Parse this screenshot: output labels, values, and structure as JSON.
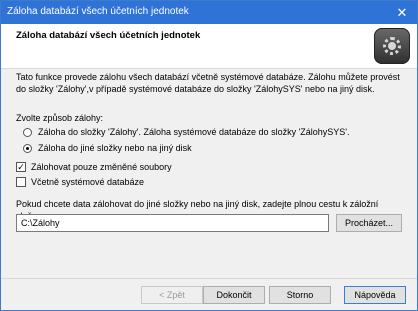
{
  "window": {
    "title": "Záloha databází všech účetních jednotek",
    "close_glyph": "✕"
  },
  "header": {
    "title": "Záloha databází všech účetních jednotek"
  },
  "description": "Tato funkce provede zálohu všech databází včetně systémové databáze. Zálohu můžete provést do složky 'Zálohy',v případě systémové databáze do složky 'ZálohySYS' nebo na jiný disk.",
  "backup_mode": {
    "label": "Zvolte způsob zálohy:",
    "options": [
      {
        "label": "Záloha do složky 'Zálohy'. Záloha systémové databáze do složky 'ZálohySYS'.",
        "selected": false
      },
      {
        "label": "Záloha do jiné složky nebo na jiný disk",
        "selected": true
      }
    ]
  },
  "checkboxes": [
    {
      "label": "Zálohovat pouze změněné soubory",
      "checked": true
    },
    {
      "label": "Včetně systémové databáze",
      "checked": false
    }
  ],
  "path": {
    "instruction": "Pokud chcete data zálohovat do jiné složky nebo na jiný disk, zadejte plnou cestu k záložní složce.",
    "value": "C:\\Zálohy",
    "browse_label": "Procházet..."
  },
  "buttons": {
    "back": "< Zpět",
    "finish": "Dokončit",
    "cancel": "Storno",
    "help": "Nápověda"
  }
}
